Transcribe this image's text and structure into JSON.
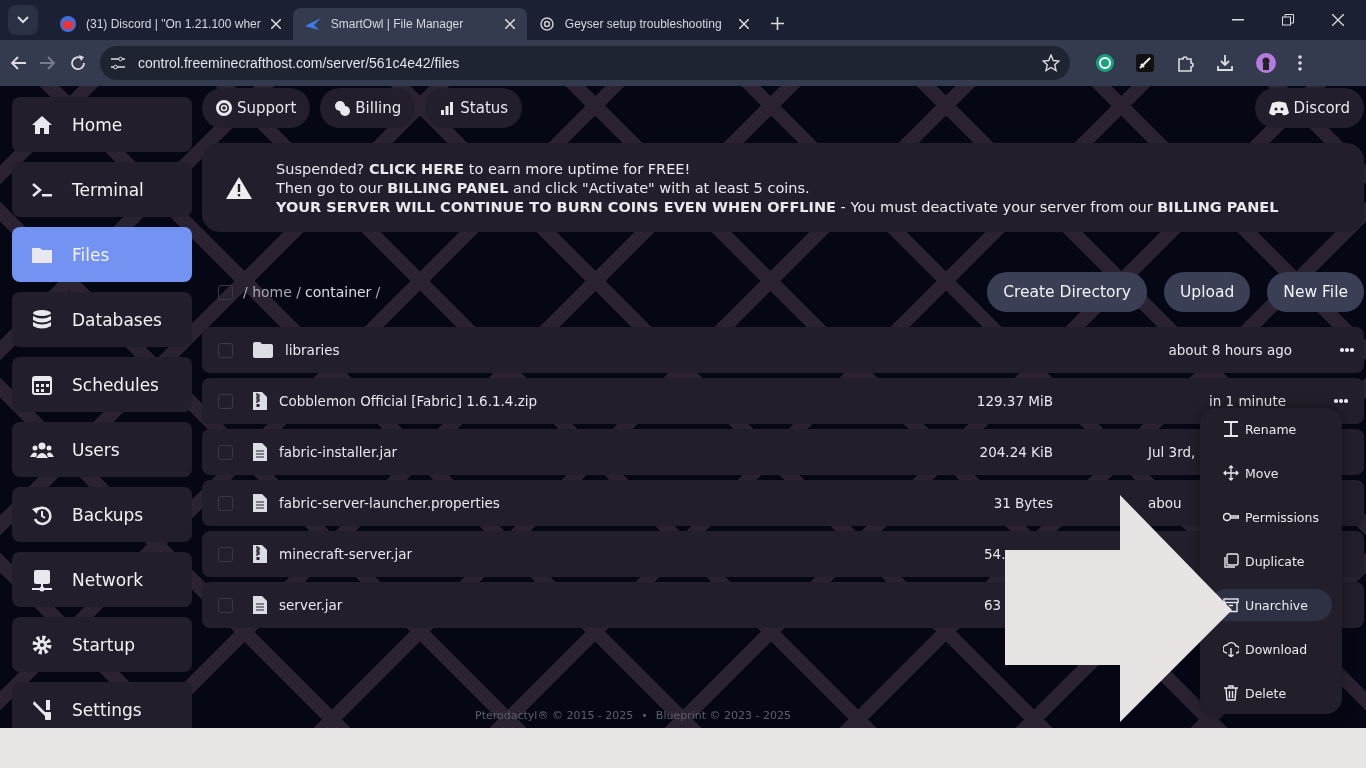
{
  "browser": {
    "tabs": [
      {
        "title": "(31) Discord | \"On 1.21.100 wher",
        "selected": false
      },
      {
        "title": "SmartOwl | File Manager",
        "selected": true
      },
      {
        "title": "Geyser setup troubleshooting",
        "selected": false
      }
    ],
    "address": "control.freeminecrafthost.com/server/561c4e42/files"
  },
  "sidebar": {
    "items": [
      {
        "label": "Home",
        "selected": false
      },
      {
        "label": "Terminal",
        "selected": false
      },
      {
        "label": "Files",
        "selected": true
      },
      {
        "label": "Databases",
        "selected": false
      },
      {
        "label": "Schedules",
        "selected": false
      },
      {
        "label": "Users",
        "selected": false
      },
      {
        "label": "Backups",
        "selected": false
      },
      {
        "label": "Network",
        "selected": false
      },
      {
        "label": "Startup",
        "selected": false
      },
      {
        "label": "Settings",
        "selected": false
      }
    ]
  },
  "top_links": [
    "Support",
    "Billing",
    "Status"
  ],
  "discord_link": "Discord",
  "banner": [
    "Suspended? **CLICK HERE** to earn more uptime for FREE!",
    "Then go to our **BILLING PANEL** and click \"Activate\" with at least 5 coins.",
    "**YOUR SERVER WILL CONTINUE TO BURN COINS EVEN WHEN OFFLINE** - You must deactivate your server from our **BILLING PANEL**"
  ],
  "select_all": {
    "checked": false
  },
  "breadcrumb": [
    {
      "label": "/ home /",
      "current": false
    },
    {
      "label": "container",
      "current": true
    },
    {
      "label": "/",
      "current": false
    }
  ],
  "actions": [
    "Create Directory",
    "Upload",
    "New File"
  ],
  "files": [
    {
      "kind": "folder",
      "checked": false,
      "name": "libraries",
      "modified": "about 8 hours ago"
    },
    {
      "kind": "archive",
      "checked": false,
      "name": "Cobblemon Official [Fabric] 1.6.1.4.zip",
      "size": "129.37 MiB",
      "modified": "in 1 minute"
    },
    {
      "kind": "file",
      "checked": false,
      "name": "fabric-installer.jar",
      "size": "204.24 KiB",
      "modified": "Jul 3rd,",
      "modified_cut": true
    },
    {
      "kind": "file",
      "checked": false,
      "name": "fabric-server-launcher.properties",
      "size": "31 Bytes",
      "modified": "abou",
      "modified_cut": true
    },
    {
      "kind": "archive",
      "checked": false,
      "name": "minecraft-server.jar",
      "size": "54.",
      "size_cut": true
    },
    {
      "kind": "file",
      "checked": false,
      "name": "server.jar",
      "size": "63",
      "size_cut": true
    }
  ],
  "context_menu": [
    {
      "label": "Rename",
      "selected": false
    },
    {
      "label": "Move",
      "selected": false
    },
    {
      "label": "Permissions",
      "selected": false
    },
    {
      "label": "Duplicate",
      "selected": false
    },
    {
      "label": "Unarchive",
      "selected": true
    },
    {
      "label": "Download",
      "selected": false
    },
    {
      "label": "Delete",
      "selected": false
    }
  ],
  "footer": {
    "left": "Pterodactyl® © 2015 - 2025",
    "separator": "•",
    "right": "Blueprint © 2023 - 2025"
  }
}
